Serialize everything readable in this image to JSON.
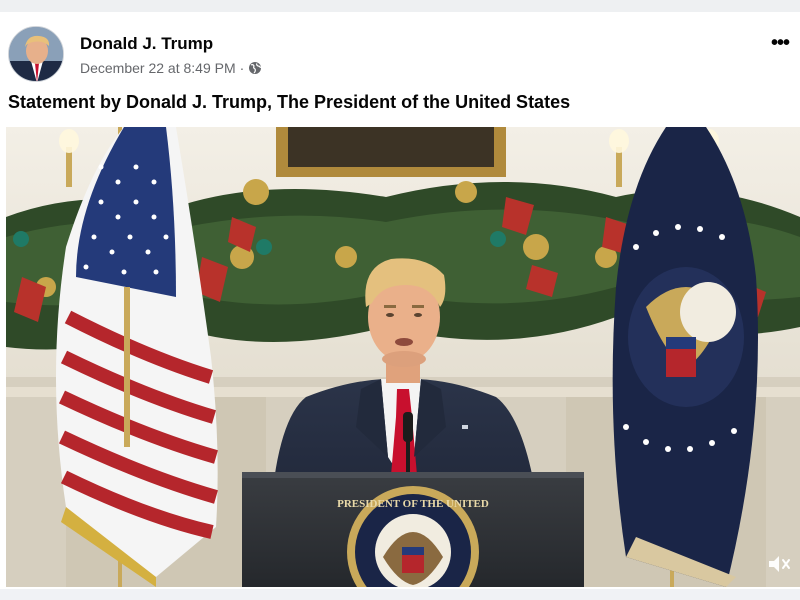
{
  "post": {
    "author": "Donald J. Trump",
    "timestamp": "December 22 at 8:49 PM",
    "separator": "·",
    "privacy_icon": "globe-icon",
    "more_icon": "more-options-icon",
    "more_label": "•••",
    "caption": "Statement by Donald J. Trump, The President of the United States",
    "video": {
      "seal_text": "PRESIDENT OF THE UNITED",
      "mute_icon": "muted-speaker-icon"
    }
  },
  "colors": {
    "text_primary": "#050505",
    "text_secondary": "#65676b",
    "background": "#ffffff"
  }
}
